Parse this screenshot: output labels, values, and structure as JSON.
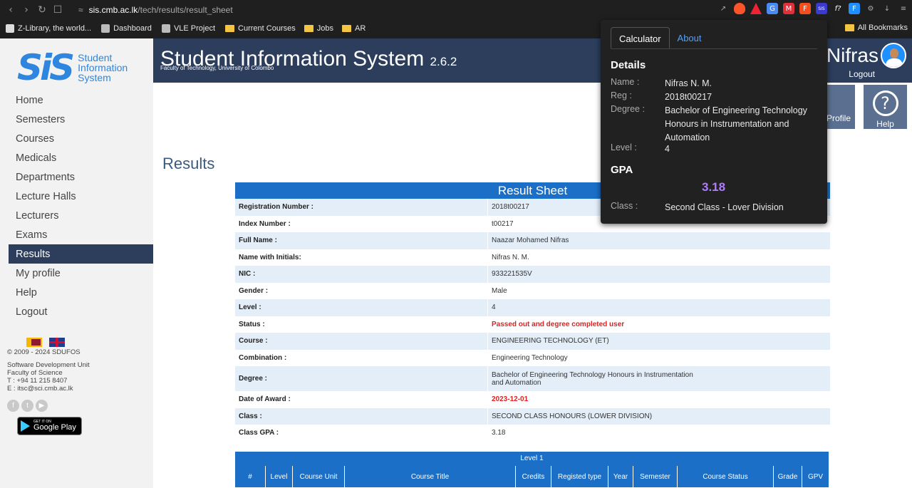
{
  "browser": {
    "url_host": "sis.cmb.ac.lk",
    "url_path": "/tech/results/result_sheet",
    "bookmarks": [
      "Z-Library, the world...",
      "Dashboard",
      "VLE Project",
      "Current Courses",
      "Jobs",
      "AR"
    ],
    "all_bookmarks": "All Bookmarks"
  },
  "sidebar": {
    "logo_mark": "SiS",
    "logo_lines": [
      "Student",
      "Information",
      "System"
    ],
    "items": [
      {
        "label": "Home"
      },
      {
        "label": "Semesters"
      },
      {
        "label": "Courses"
      },
      {
        "label": "Medicals"
      },
      {
        "label": "Departments"
      },
      {
        "label": "Lecture Halls"
      },
      {
        "label": "Lecturers"
      },
      {
        "label": "Exams"
      },
      {
        "label": "Results"
      },
      {
        "label": "My profile"
      },
      {
        "label": "Help"
      },
      {
        "label": "Logout"
      }
    ],
    "copyright": "© 2009 - 2024 SDUFOS",
    "sdu_lines": [
      "Software Development Unit",
      "Faculty of Science",
      "T : +94 11 215 8407",
      "E : itsc@sci.cmb.ac.lk"
    ],
    "gplay_small": "GET IT ON",
    "gplay_big": "Google Play"
  },
  "header": {
    "title": "Student Information System",
    "version": "2.6.2",
    "subtitle": "Faculty of Technology, University of Colombo",
    "user": "d Nifras",
    "logout": "Logout"
  },
  "tiles": {
    "profile": "Profile",
    "help": "Help"
  },
  "page": {
    "heading": "Results"
  },
  "result_sheet": {
    "title": "Result Sheet",
    "rows": [
      {
        "label": "Registration Number :",
        "value": "2018t00217"
      },
      {
        "label": "Index Number :",
        "value": "t00217"
      },
      {
        "label": "Full Name :",
        "value": "Naazar Mohamed Nifras"
      },
      {
        "label": "Name with Initials:",
        "value": "Nifras N. M."
      },
      {
        "label": "NIC :",
        "value": "933221535V"
      },
      {
        "label": "Gender :",
        "value": "Male"
      },
      {
        "label": "Level :",
        "value": "4"
      },
      {
        "label": "Status :",
        "value": "Passed out and degree completed user"
      },
      {
        "label": "Course :",
        "value": "ENGINEERING TECHNOLOGY (ET)"
      },
      {
        "label": "Combination :",
        "value": "Engineering Technology"
      },
      {
        "label": "Degree :",
        "value": "Bachelor of Engineering Technology Honours in Instrumentation and Automation"
      },
      {
        "label": "Date of Award :",
        "value": "2023-12-01"
      },
      {
        "label": "Class :",
        "value": "SECOND CLASS HONOURS (LOWER DIVISION)"
      },
      {
        "label": "Class GPA :",
        "value": "3.18"
      }
    ]
  },
  "level_table": {
    "title": "Level 1",
    "columns": [
      "#",
      "Level",
      "Course Unit",
      "Course Title",
      "Credits",
      "Registed type",
      "Year",
      "Semester",
      "Course Status",
      "Grade",
      "GPV"
    ]
  },
  "popup": {
    "tabs": [
      "Calculator",
      "About"
    ],
    "details_heading": "Details",
    "details": [
      {
        "key": "Name :",
        "value": "Nifras N. M."
      },
      {
        "key": "Reg :",
        "value": "2018t00217"
      },
      {
        "key": "Degree :",
        "value": "Bachelor of Engineering Technology Honours in Instrumentation and Automation"
      },
      {
        "key": "Level :",
        "value": "4"
      }
    ],
    "gpa_heading": "GPA",
    "gpa_value": "3.18",
    "class_key": "Class :",
    "class_value": "Second Class - Lover Division"
  }
}
